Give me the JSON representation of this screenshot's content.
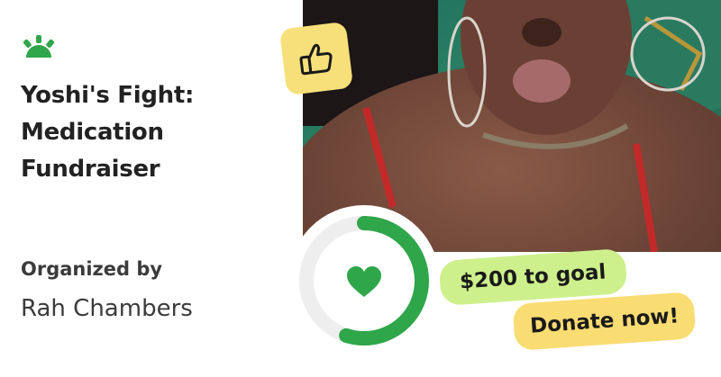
{
  "brand": {
    "logo_icon": "gofundme-sun-icon",
    "accent_color": "#2fa64a"
  },
  "campaign": {
    "title": "Yoshi's Fight: Medication Fundraiser"
  },
  "organizer": {
    "heading": "Organized by",
    "name": "Rah Chambers"
  },
  "progress": {
    "icon": "heart-icon",
    "fraction_complete": 0.55,
    "ring_color": "#2fa64a",
    "track_color": "#eeeeee"
  },
  "badges": {
    "like_icon": "thumbs-up-icon",
    "goal_text": "$200 to goal",
    "goal_color": "#cdf08c",
    "donate_label": "Donate now!",
    "donate_color": "#f9dc72"
  }
}
